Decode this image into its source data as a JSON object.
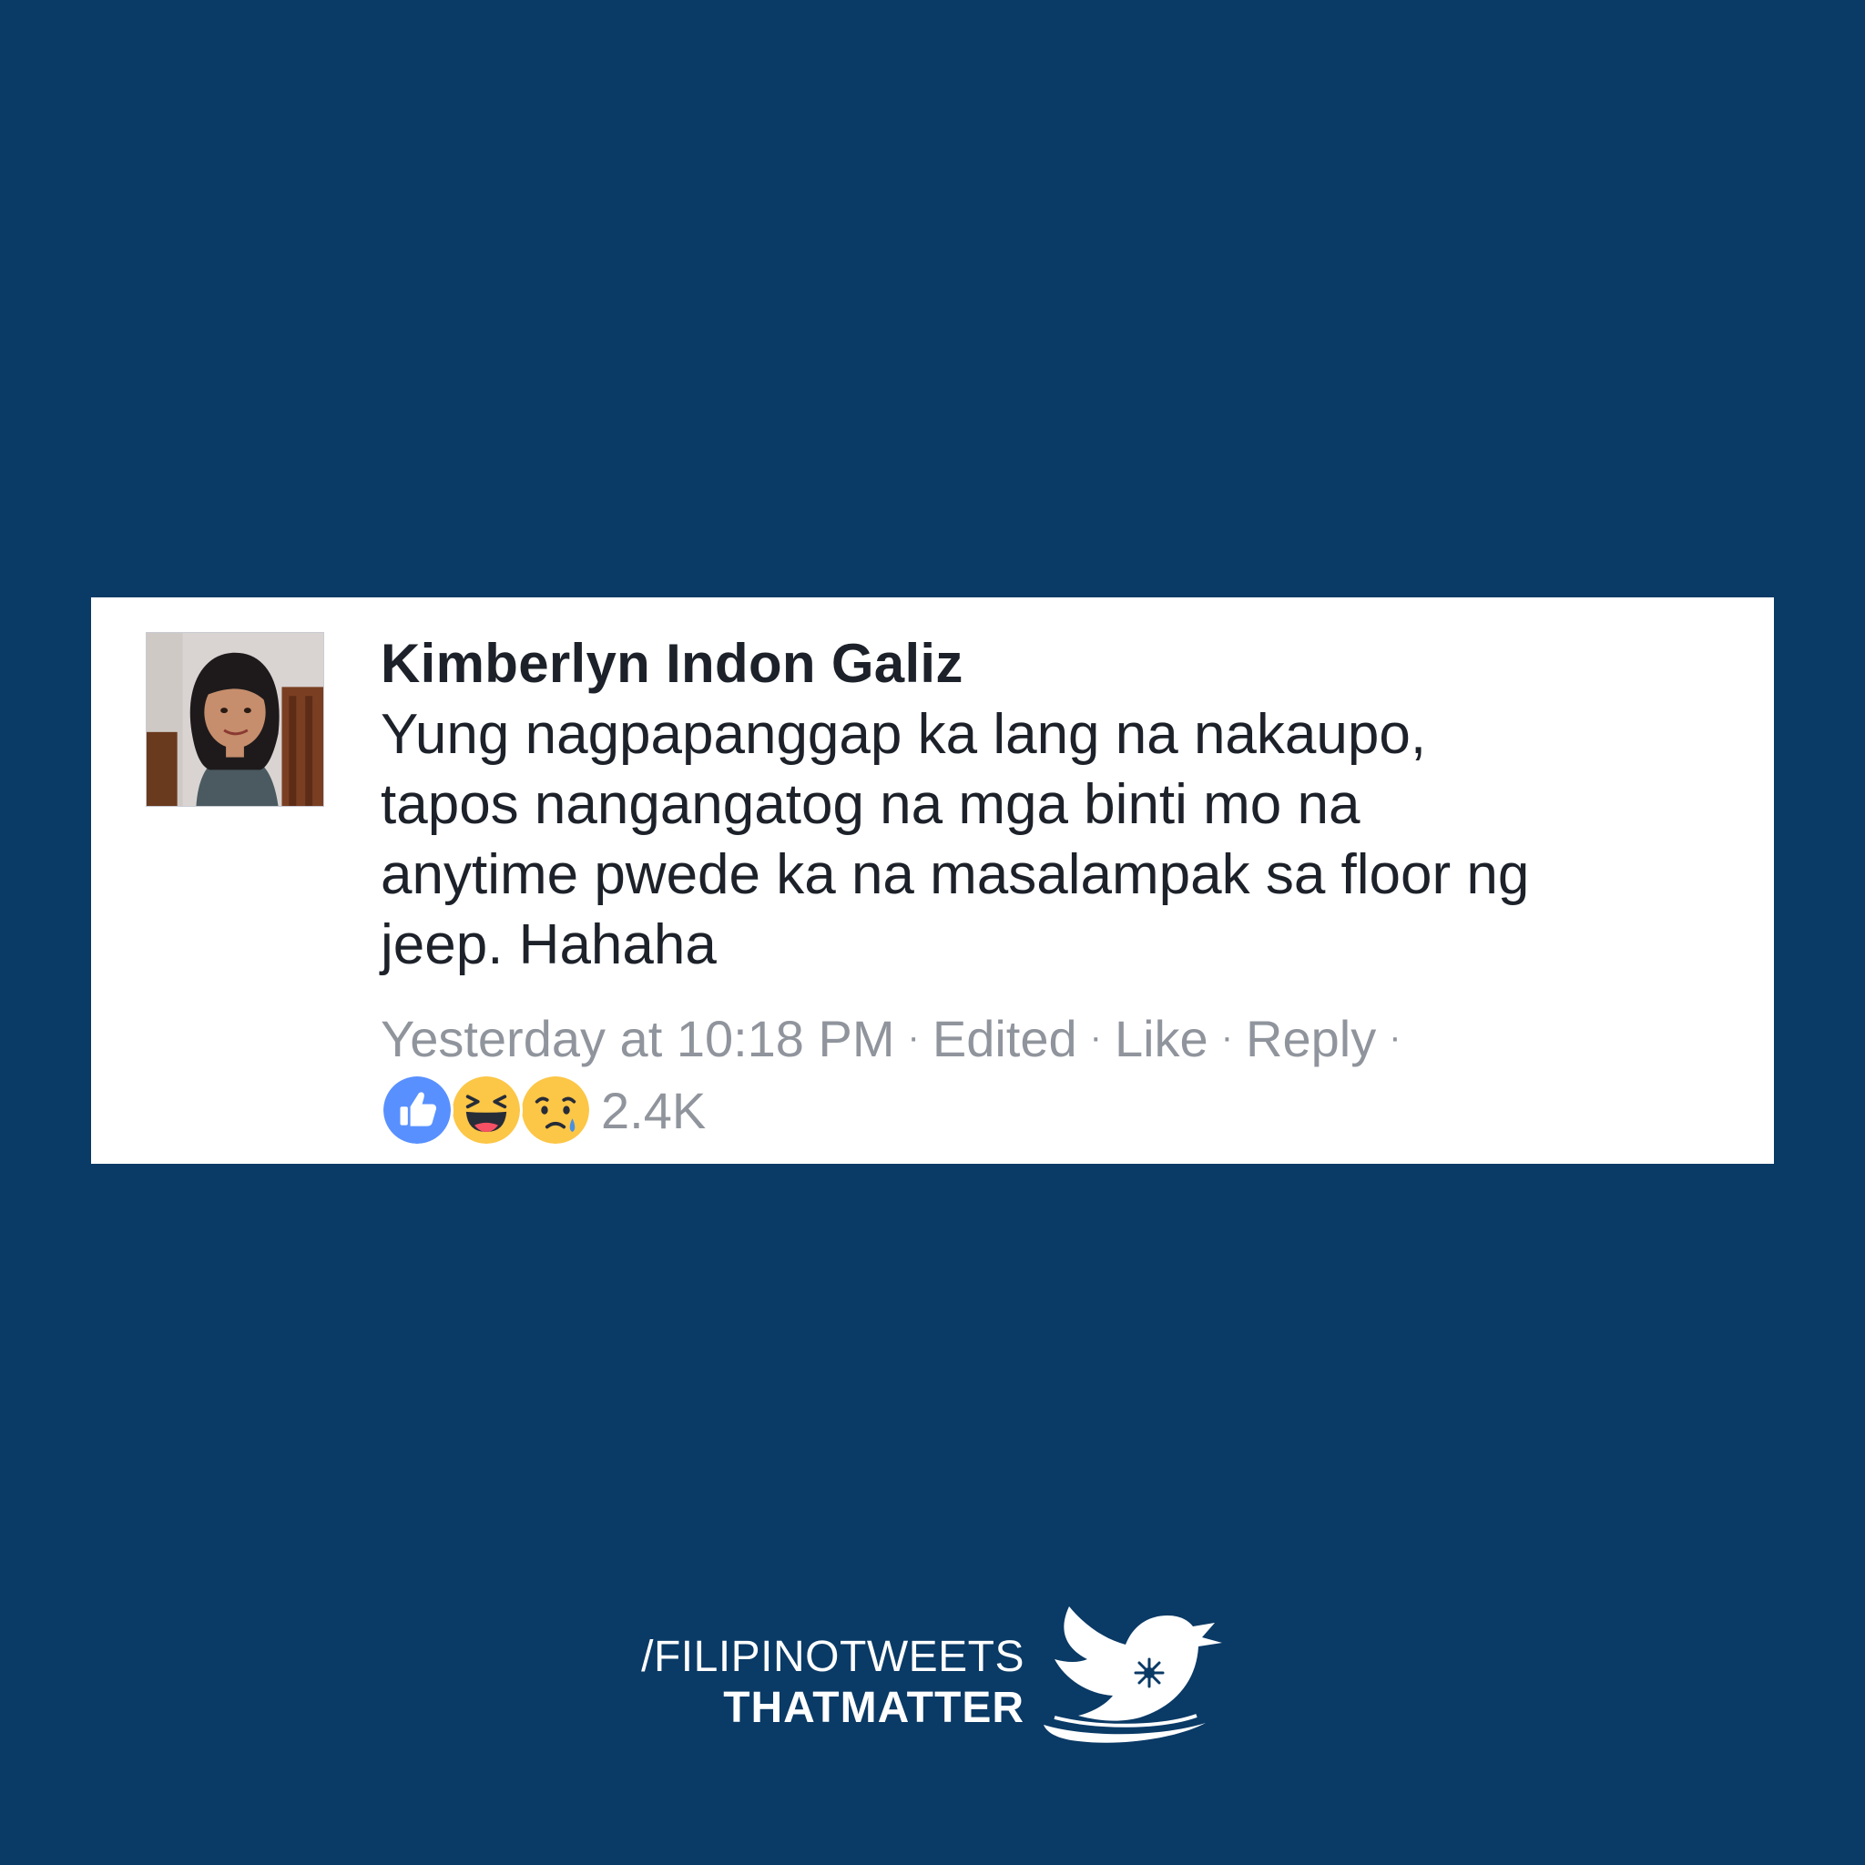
{
  "comment": {
    "author": "Kimberlyn Indon Galiz",
    "body_lines": [
      "Yung nagpapanggap ka lang na nakaupo,",
      "tapos nangangatog na mga binti mo na",
      "anytime pwede ka na masalampak sa floor ng",
      "jeep. Hahaha"
    ],
    "timestamp": "Yesterday at 10:18 PM",
    "edited_label": "Edited",
    "like_label": "Like",
    "reply_label": "Reply",
    "separator": "·",
    "reactions": {
      "icons": [
        "like-reaction-icon",
        "haha-reaction-icon",
        "sad-reaction-icon"
      ],
      "count": "2.4K"
    }
  },
  "branding": {
    "line1": "/FILIPINOTWEETS",
    "line2": "THATMATTER",
    "logo": "bird-icon"
  },
  "colors": {
    "background": "#0a3a66",
    "card": "#ffffff",
    "author_text": "#1d2129",
    "meta_text": "#90949c",
    "like_blue": "#5890ff",
    "emoji_yellow": "#fcc646"
  }
}
